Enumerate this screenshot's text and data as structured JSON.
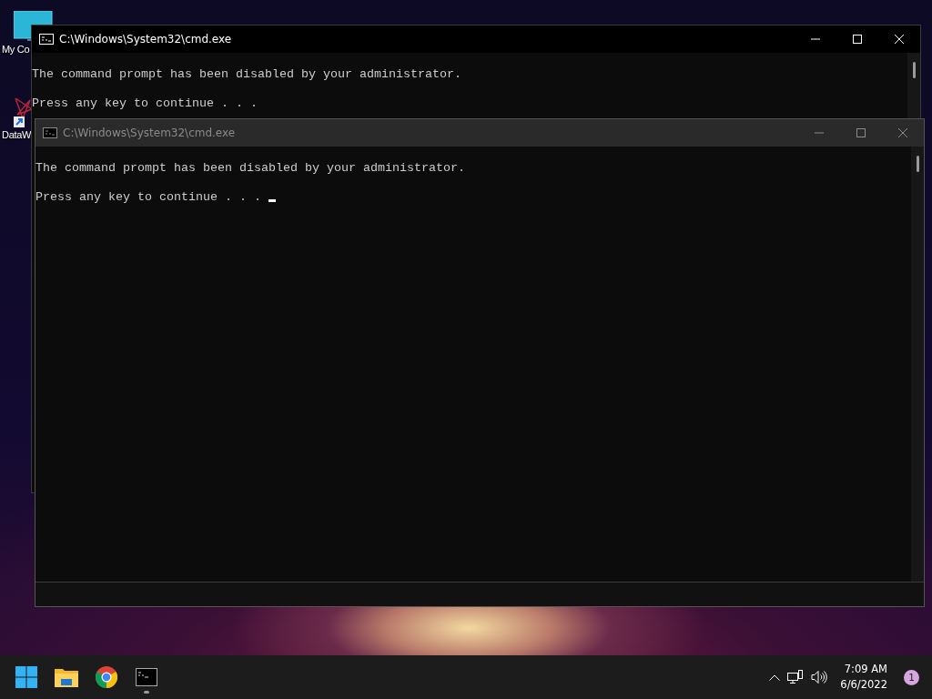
{
  "desktop_icons": [
    {
      "kind": "monitor",
      "label": "My Co"
    },
    {
      "kind": "shortcut",
      "label": "DataW"
    }
  ],
  "windows": [
    {
      "title": "C:\\Windows\\System32\\cmd.exe",
      "active": true,
      "cursor": false,
      "lines": [
        "The command prompt has been disabled by your administrator.",
        "Press any key to continue . . ."
      ]
    },
    {
      "title": "C:\\Windows\\System32\\cmd.exe",
      "active": false,
      "cursor": true,
      "lines": [
        "The command prompt has been disabled by your administrator.",
        "Press any key to continue . . ."
      ]
    }
  ],
  "taskbar": {
    "apps": [
      {
        "kind": "start",
        "running": false
      },
      {
        "kind": "folder",
        "running": false
      },
      {
        "kind": "browser",
        "running": false
      },
      {
        "kind": "terminal",
        "running": true
      }
    ],
    "time": "7:09 AM",
    "date": "6/6/2022",
    "notifications": "1"
  }
}
